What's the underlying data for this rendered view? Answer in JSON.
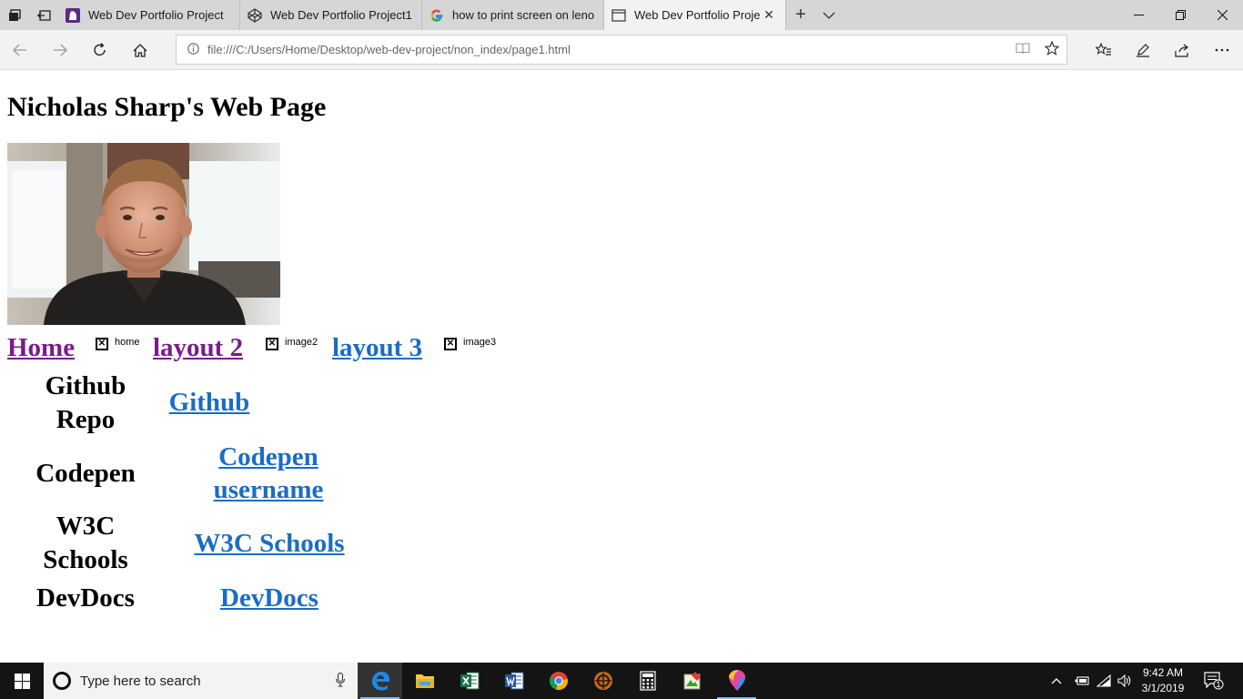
{
  "tabs": [
    {
      "title": "Web Dev Portfolio Project",
      "icon": "wolf-icon",
      "active": false
    },
    {
      "title": "Web Dev Portfolio Project1",
      "icon": "codepen-icon",
      "active": false
    },
    {
      "title": "how to print screen on leno",
      "icon": "google-icon",
      "active": false
    },
    {
      "title": "Web Dev Portfolio Proje",
      "icon": "page-icon",
      "active": true
    }
  ],
  "address": {
    "url": "file:///C:/Users/Home/Desktop/web-dev-project/non_index/page1.html"
  },
  "page": {
    "title": "Nicholas Sharp's Web Page",
    "nav": [
      {
        "label": "Home",
        "image_alt": "home",
        "visited": true
      },
      {
        "label": "layout 2",
        "image_alt": "image2",
        "visited": true
      },
      {
        "label": "layout 3",
        "image_alt": "image3",
        "visited": false
      }
    ],
    "resources": [
      {
        "label": "Github Repo",
        "link": "Github"
      },
      {
        "label": "Codepen",
        "link": "Codepen username"
      },
      {
        "label": "W3C Schools",
        "link": "W3C Schools"
      },
      {
        "label": "DevDocs",
        "link": "DevDocs"
      }
    ]
  },
  "taskbar": {
    "search_placeholder": "Type here to search",
    "apps": [
      "edge-icon",
      "file-explorer-icon",
      "excel-icon",
      "word-icon",
      "chrome-icon",
      "game-icon",
      "calculator-icon",
      "image-editor-icon",
      "paint-3d-icon"
    ],
    "time": "9:42 AM",
    "date": "3/1/2019",
    "notification_count": "1"
  },
  "colors": {
    "visited_link": "#7a1b8c",
    "link": "#1a6dc5",
    "tabbar": "#d6d6d6",
    "taskbar": "#141414"
  }
}
